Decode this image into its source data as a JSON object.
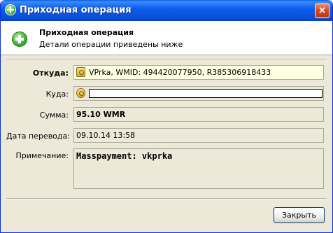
{
  "window": {
    "title": "Приходная операция",
    "close_symbol": "×"
  },
  "header": {
    "title": "Приходная операция",
    "subtitle": "Детали операции приведены ниже"
  },
  "form": {
    "from": {
      "label": "Откуда:",
      "value": "VPrka, WMID: 494420077950, R385306918433"
    },
    "to": {
      "label": "Куда:",
      "value": ""
    },
    "amount": {
      "label": "Сумма:",
      "value": "95.10 WMR"
    },
    "date": {
      "label": "Дата перевода:",
      "value": "09.10.14 13:58"
    },
    "note": {
      "label": "Примечание:",
      "value": "Masspayment: vkprka"
    }
  },
  "buttons": {
    "close_label": "Закрыть"
  },
  "icons": {
    "title": "plus-circle-icon",
    "header": "plus-circle-icon",
    "from": "webmoney-key-icon",
    "to": "webmoney-key-icon"
  },
  "colors": {
    "titlebar": "#0a5fe8",
    "dialog_bg": "#ece9d8",
    "highlight_field": "#ffffe1"
  }
}
